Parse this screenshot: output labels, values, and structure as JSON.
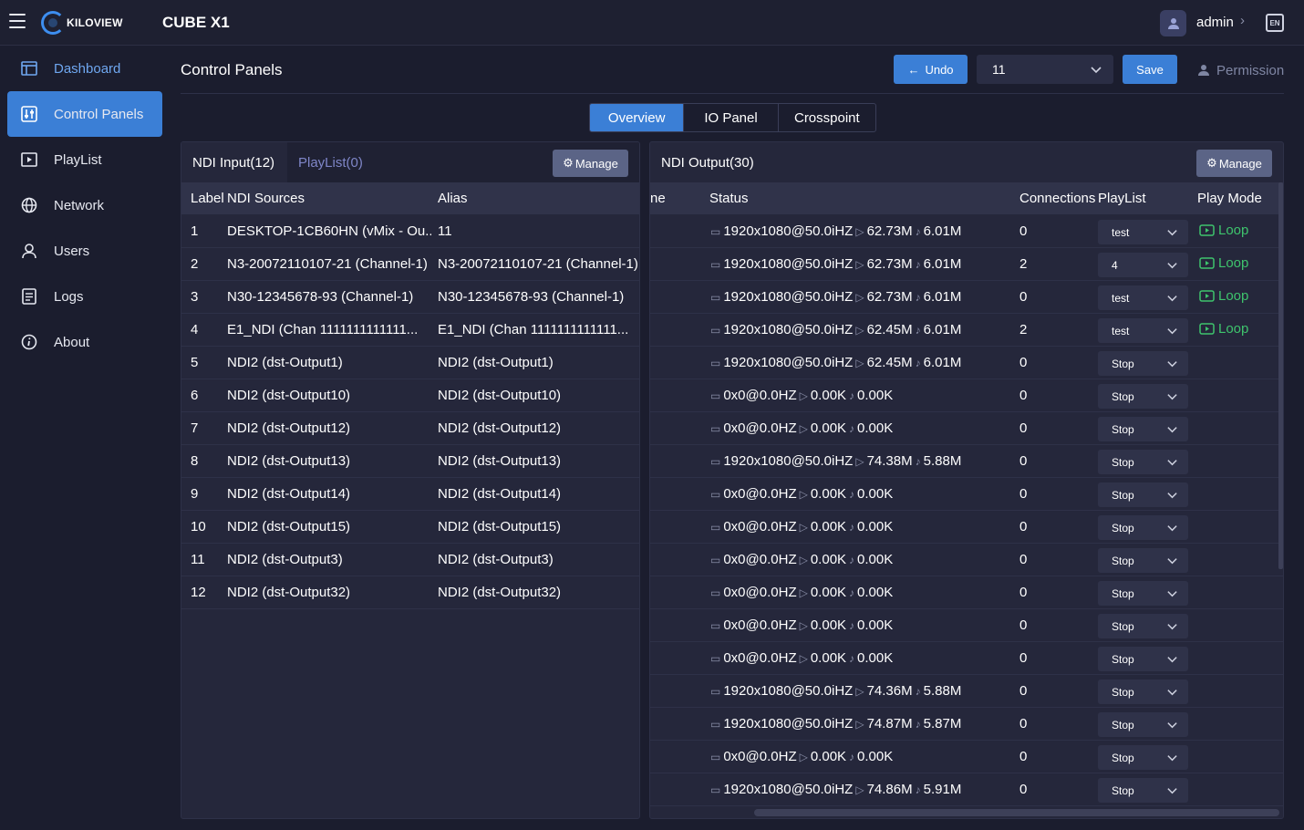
{
  "app": {
    "logo_text": "KILOVIEW",
    "product_name": "CUBE X1",
    "user_name": "admin",
    "lang": "EN"
  },
  "sidebar": {
    "items": [
      {
        "label": "Dashboard",
        "icon": "dashboard-icon"
      },
      {
        "label": "Control Panels",
        "icon": "sliders-icon"
      },
      {
        "label": "PlayList",
        "icon": "playlist-icon"
      },
      {
        "label": "Network",
        "icon": "globe-icon"
      },
      {
        "label": "Users",
        "icon": "user-icon"
      },
      {
        "label": "Logs",
        "icon": "document-icon"
      },
      {
        "label": "About",
        "icon": "info-icon"
      }
    ]
  },
  "header": {
    "title": "Control Panels",
    "undo_label": "Undo",
    "scene_value": "11",
    "save_label": "Save",
    "permission_label": "Permission"
  },
  "tabs": [
    "Overview",
    "IO Panel",
    "Crosspoint"
  ],
  "input_panel": {
    "tab_active": "NDI Input(12)",
    "tab_inactive": "PlayList(0)",
    "manage_label": "Manage",
    "columns": [
      "Label",
      "NDI Sources",
      "Alias"
    ],
    "rows": [
      {
        "label": "1",
        "source": "DESKTOP-1CB60HN (vMix - Ou...",
        "alias": "11"
      },
      {
        "label": "2",
        "source": "N3-20072110107-21 (Channel-1)",
        "alias": "N3-20072110107-21 (Channel-1)"
      },
      {
        "label": "3",
        "source": "N30-12345678-93 (Channel-1)",
        "alias": "N30-12345678-93 (Channel-1)"
      },
      {
        "label": "4",
        "source": "E1_NDI (Chan 1111111111111...",
        "alias": "E1_NDI (Chan 1111111111111..."
      },
      {
        "label": "5",
        "source": "NDI2 (dst-Output1)",
        "alias": "NDI2 (dst-Output1)"
      },
      {
        "label": "6",
        "source": "NDI2 (dst-Output10)",
        "alias": "NDI2 (dst-Output10)"
      },
      {
        "label": "7",
        "source": "NDI2 (dst-Output12)",
        "alias": "NDI2 (dst-Output12)"
      },
      {
        "label": "8",
        "source": "NDI2 (dst-Output13)",
        "alias": "NDI2 (dst-Output13)"
      },
      {
        "label": "9",
        "source": "NDI2 (dst-Output14)",
        "alias": "NDI2 (dst-Output14)"
      },
      {
        "label": "10",
        "source": "NDI2 (dst-Output15)",
        "alias": "NDI2 (dst-Output15)"
      },
      {
        "label": "11",
        "source": "NDI2 (dst-Output3)",
        "alias": "NDI2 (dst-Output3)"
      },
      {
        "label": "12",
        "source": "NDI2 (dst-Output32)",
        "alias": "NDI2 (dst-Output32)"
      }
    ]
  },
  "output_panel": {
    "title": "NDI Output(30)",
    "manage_label": "Manage",
    "columns": [
      "ne",
      "Status",
      "Connections",
      "PlayList",
      "Play Mode"
    ],
    "rows": [
      {
        "res": "1920x1080@50.0iHZ",
        "bitrate": "62.73M",
        "audio": "6.01M",
        "conn": "0",
        "playlist": "test",
        "mode": "Loop"
      },
      {
        "res": "1920x1080@50.0iHZ",
        "bitrate": "62.73M",
        "audio": "6.01M",
        "conn": "2",
        "playlist": "4",
        "mode": "Loop"
      },
      {
        "res": "1920x1080@50.0iHZ",
        "bitrate": "62.73M",
        "audio": "6.01M",
        "conn": "0",
        "playlist": "test",
        "mode": "Loop"
      },
      {
        "res": "1920x1080@50.0iHZ",
        "bitrate": "62.45M",
        "audio": "6.01M",
        "conn": "2",
        "playlist": "test",
        "mode": "Loop"
      },
      {
        "res": "1920x1080@50.0iHZ",
        "bitrate": "62.45M",
        "audio": "6.01M",
        "conn": "0",
        "playlist": "Stop",
        "mode": ""
      },
      {
        "res": "0x0@0.0HZ",
        "bitrate": "0.00K",
        "audio": "0.00K",
        "conn": "0",
        "playlist": "Stop",
        "mode": ""
      },
      {
        "res": "0x0@0.0HZ",
        "bitrate": "0.00K",
        "audio": "0.00K",
        "conn": "0",
        "playlist": "Stop",
        "mode": ""
      },
      {
        "res": "1920x1080@50.0iHZ",
        "bitrate": "74.38M",
        "audio": "5.88M",
        "conn": "0",
        "playlist": "Stop",
        "mode": ""
      },
      {
        "res": "0x0@0.0HZ",
        "bitrate": "0.00K",
        "audio": "0.00K",
        "conn": "0",
        "playlist": "Stop",
        "mode": ""
      },
      {
        "res": "0x0@0.0HZ",
        "bitrate": "0.00K",
        "audio": "0.00K",
        "conn": "0",
        "playlist": "Stop",
        "mode": ""
      },
      {
        "res": "0x0@0.0HZ",
        "bitrate": "0.00K",
        "audio": "0.00K",
        "conn": "0",
        "playlist": "Stop",
        "mode": ""
      },
      {
        "res": "0x0@0.0HZ",
        "bitrate": "0.00K",
        "audio": "0.00K",
        "conn": "0",
        "playlist": "Stop",
        "mode": ""
      },
      {
        "res": "0x0@0.0HZ",
        "bitrate": "0.00K",
        "audio": "0.00K",
        "conn": "0",
        "playlist": "Stop",
        "mode": ""
      },
      {
        "res": "0x0@0.0HZ",
        "bitrate": "0.00K",
        "audio": "0.00K",
        "conn": "0",
        "playlist": "Stop",
        "mode": ""
      },
      {
        "res": "1920x1080@50.0iHZ",
        "bitrate": "74.36M",
        "audio": "5.88M",
        "conn": "0",
        "playlist": "Stop",
        "mode": ""
      },
      {
        "res": "1920x1080@50.0iHZ",
        "bitrate": "74.87M",
        "audio": "5.87M",
        "conn": "0",
        "playlist": "Stop",
        "mode": ""
      },
      {
        "res": "0x0@0.0HZ",
        "bitrate": "0.00K",
        "audio": "0.00K",
        "conn": "0",
        "playlist": "Stop",
        "mode": ""
      },
      {
        "res": "1920x1080@50.0iHZ",
        "bitrate": "74.86M",
        "audio": "5.91M",
        "conn": "0",
        "playlist": "Stop",
        "mode": ""
      }
    ]
  },
  "colors": {
    "accent": "#3b7fd6",
    "loop_green": "#3ec46d",
    "background": "#1b1d2e"
  }
}
